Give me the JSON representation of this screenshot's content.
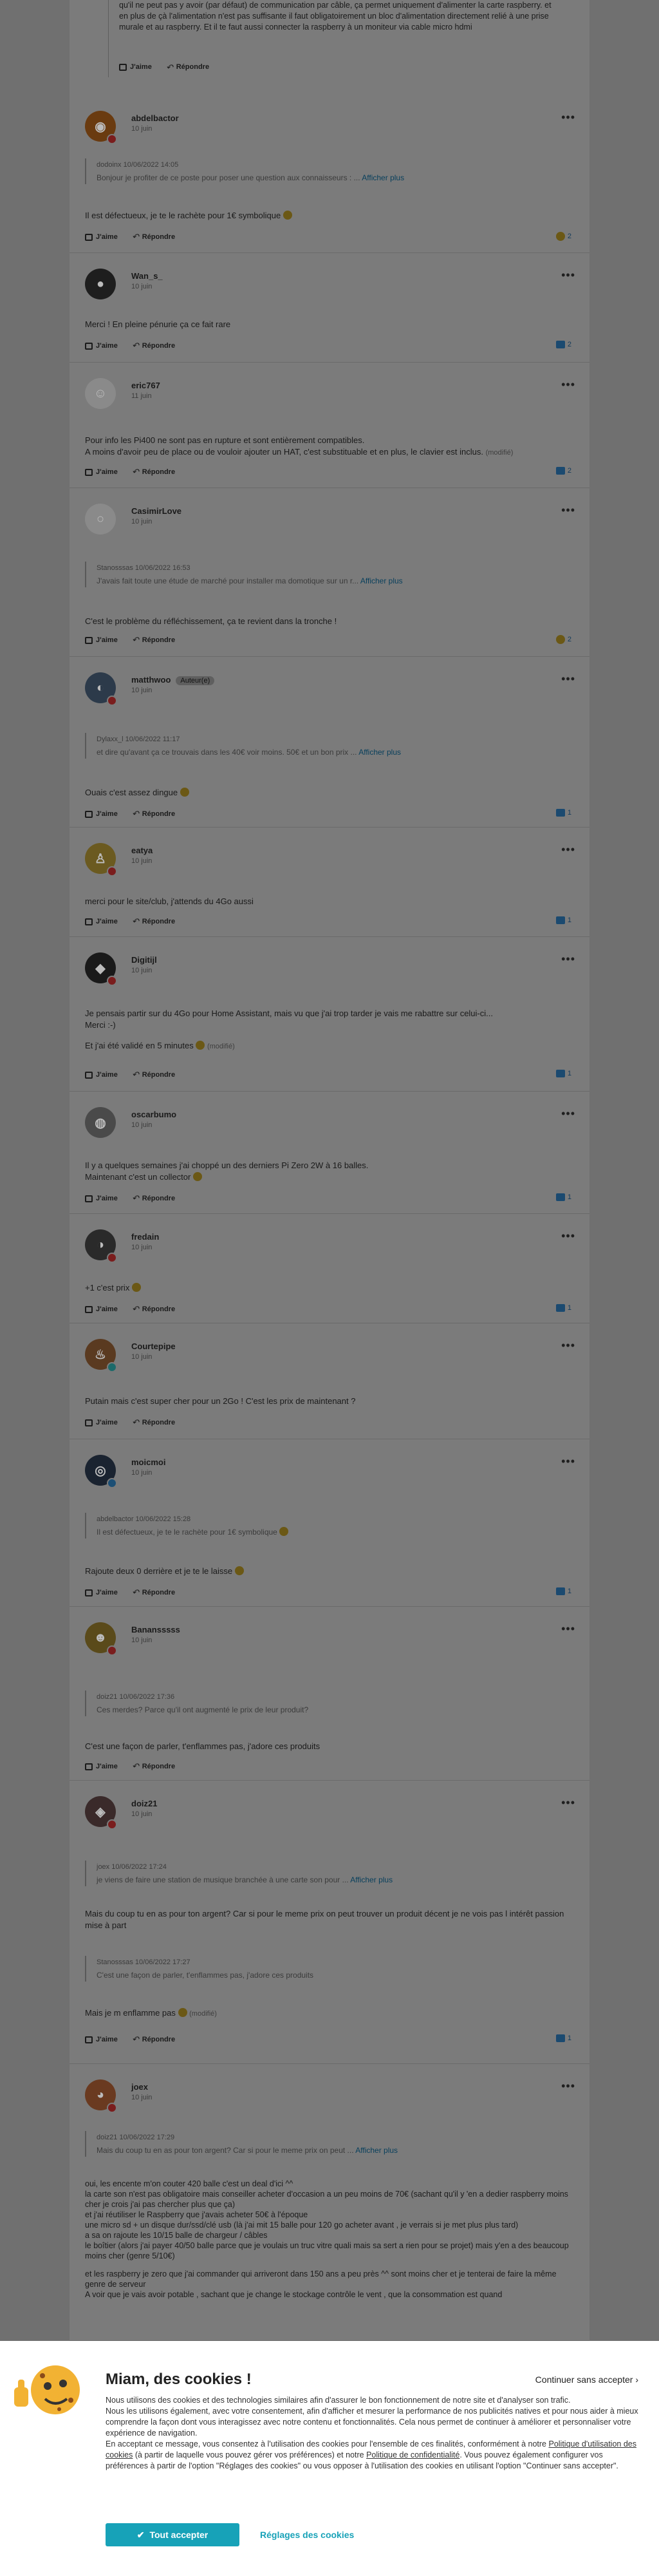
{
  "actions": {
    "like": "J'aime",
    "reply": "Répondre",
    "more_link": "Afficher plus"
  },
  "top_reply": {
    "text": "qu'il ne peut pas y avoir (par défaut) de communication par câble, ça permet uniquement d'alimenter la carte raspberry. et en plus de çà l'alimentation n'est pas suffisante il faut obligatoirement un bloc d'alimentation directement relié à une prise murale et au raspberry. Et il te faut aussi connecter la raspberry à un moniteur via cable micro hdmi"
  },
  "comments": [
    {
      "user": "abdelbactor",
      "date": "10 juin",
      "quote_head": "dodoinx 10/06/2022 14:05",
      "quote": "Bonjour je profiter de ce poste pour poser une question aux connaisseurs : ...",
      "text": "Il est défectueux, je te le rachète pour 1€ symbolique",
      "count": "2"
    },
    {
      "user": "Wan_s_",
      "date": "10 juin",
      "text": "Merci ! En pleine pénurie ça ce fait rare",
      "count": "2"
    },
    {
      "user": "eric767",
      "date": "11 juin",
      "text": "Pour info les Pi400 ne sont pas en rupture et sont entièrement compatibles.",
      "text2": "A moins d'avoir peu de place ou de vouloir ajouter un HAT, c'est substituable et en plus, le clavier est inclus.",
      "edited": "(modifié)",
      "count": "2"
    },
    {
      "user": "CasimirLove",
      "date": "10 juin",
      "quote_head": "Stanosssas 10/06/2022 16:53",
      "quote": "J'avais fait toute une étude de marché pour installer ma domotique sur un r...",
      "text": "C'est le problème du réfléchissement, ça te revient dans la tronche !",
      "count": "2"
    },
    {
      "user": "matthwoo",
      "badge": "Auteur(e)",
      "date": "10 juin",
      "quote_head": "Dylaxx_l 10/06/2022 11:17",
      "quote": "et dire qu'avant ça ce trouvais dans les 40€ voir moins. 50€ et un bon prix ...",
      "text": "Ouais c'est assez dingue",
      "count": "1"
    },
    {
      "user": "eatya",
      "date": "10 juin",
      "text": "merci pour le site/club, j'attends du 4Go aussi",
      "count": "1"
    },
    {
      "user": "Digitijl",
      "date": "10 juin",
      "text": "Je pensais partir sur du 4Go pour Home Assistant, mais vu que j'ai trop tarder je vais me rabattre sur celui-ci...",
      "text2": "Merci :-)",
      "text3": "Et j'ai été validé en 5 minutes",
      "edited": "(modifié)",
      "count": "1"
    },
    {
      "user": "oscarbumo",
      "date": "10 juin",
      "text": "Il y a quelques semaines j'ai choppé un des derniers Pi Zero 2W à 16 balles.",
      "text2": "Maintenant c'est un collector",
      "count": "1"
    },
    {
      "user": "fredain",
      "date": "10 juin",
      "text": "+1 c'est prix",
      "count": "1"
    },
    {
      "user": "Courtepipe",
      "date": "10 juin",
      "text": "Putain mais c'est super cher pour un 2Go ! C'est les prix de maintenant ?"
    },
    {
      "user": "moicmoi",
      "date": "10 juin",
      "quote_head": "abdelbactor 10/06/2022 15:28",
      "quote": "Il est défectueux, je te le rachète pour 1€ symbolique",
      "text": "Rajoute deux 0 derrière et je te le laisse",
      "count": "1"
    },
    {
      "user": "Banansssss",
      "date": "10 juin",
      "quote_head": "doiz21 10/06/2022 17:36",
      "quote": "Ces merdes? Parce qu'il ont augmenté le prix de leur produit?",
      "text": "C'est une façon de parler, t'enflammes pas, j'adore ces produits"
    },
    {
      "user": "doiz21",
      "date": "10 juin",
      "quote_head": "joex 10/06/2022 17:24",
      "quote": "je viens de faire une station de musique branchée à une carte son pour ...",
      "text": "Mais du coup tu en as pour ton argent? Car si pour le meme prix on peut trouver un produit décent je ne vois pas l intérêt passion mise à part",
      "quote2_head": "Stanosssas 10/06/2022 17:27",
      "quote2": "C'est une façon de parler, t'enflammes pas, j'adore ces produits",
      "text2": "Mais je m enflamme pas",
      "edited": "(modifié)",
      "count": "1"
    },
    {
      "user": "joex",
      "date": "10 juin",
      "quote_head": "doiz21 10/06/2022 17:29",
      "quote": "Mais du coup tu en as pour ton argent? Car si pour le meme prix on peut ...",
      "lines": [
        "oui, les encente m'on couter 420 balle c'est un deal d'ici ^^",
        "la carte son n'est pas obligatoire mais conseiller acheter d'occasion a un peu moins de 70€ (sachant qu'il y 'en a dedier raspberry moins cher je crois j'ai pas chercher plus que ça)",
        "et j'ai réutiliser le Raspberry que j'avais acheter 50€ à l'époque",
        "une micro sd + un disque dur/ssd/clé usb (là j'ai mit 15 balle pour 120 go acheter avant , je verrais si je met plus plus tard)",
        "a sa on rajoute les 10/15 balle de chargeur / câbles",
        "le boîtier (alors j'ai payer 40/50 balle parce que je voulais un truc vitre quali mais sa sert a rien pour se projet) mais y'en a des beaucoup moins cher (genre 5/10€)",
        "",
        "et les raspberry je zero que j'ai commander qui arriveront dans 150 ans a peu près ^^ sont moins cher et je tenterai de faire la même genre de serveur",
        "A voir que je vais avoir potable , sachant que je change le stockage contrôle le vent , que la consommation est quand"
      ]
    }
  ],
  "cookie": {
    "title": "Miam, des cookies !",
    "skip": "Continuer sans accepter",
    "p1": "Nous utilisons des cookies et des technologies similaires afin d'assurer le bon fonctionnement de notre site et d'analyser son trafic.",
    "p2": "Nous les utilisons également, avec votre consentement, afin d'afficher et mesurer la performance de nos publicités natives et pour nous aider à mieux comprendre la façon dont vous interagissez avec notre contenu et fonctionnalités. Cela nous permet de continuer à améliorer et personnaliser votre expérience de navigation.",
    "p3a": "En acceptant ce message, vous consentez à l'utilisation des cookies pour l'ensemble de ces finalités, conformément à notre ",
    "link1": "Politique d'utilisation des cookies",
    "p3b": " (à partir de laquelle vous pouvez gérer vos préférences) et notre ",
    "link2": "Politique de confidentialité",
    "p3c": ". Vous pouvez également configurer vos préférences à partir de l'option \"Réglages des cookies\" ou vous opposer à l'utilisation des cookies en utilisant l'option \"Continuer sans accepter\".",
    "accept": "Tout accepter",
    "settings": "Réglages des cookies"
  },
  "colors": {
    "accent": "#17a2b8",
    "overlay": "#7b7b7b"
  }
}
